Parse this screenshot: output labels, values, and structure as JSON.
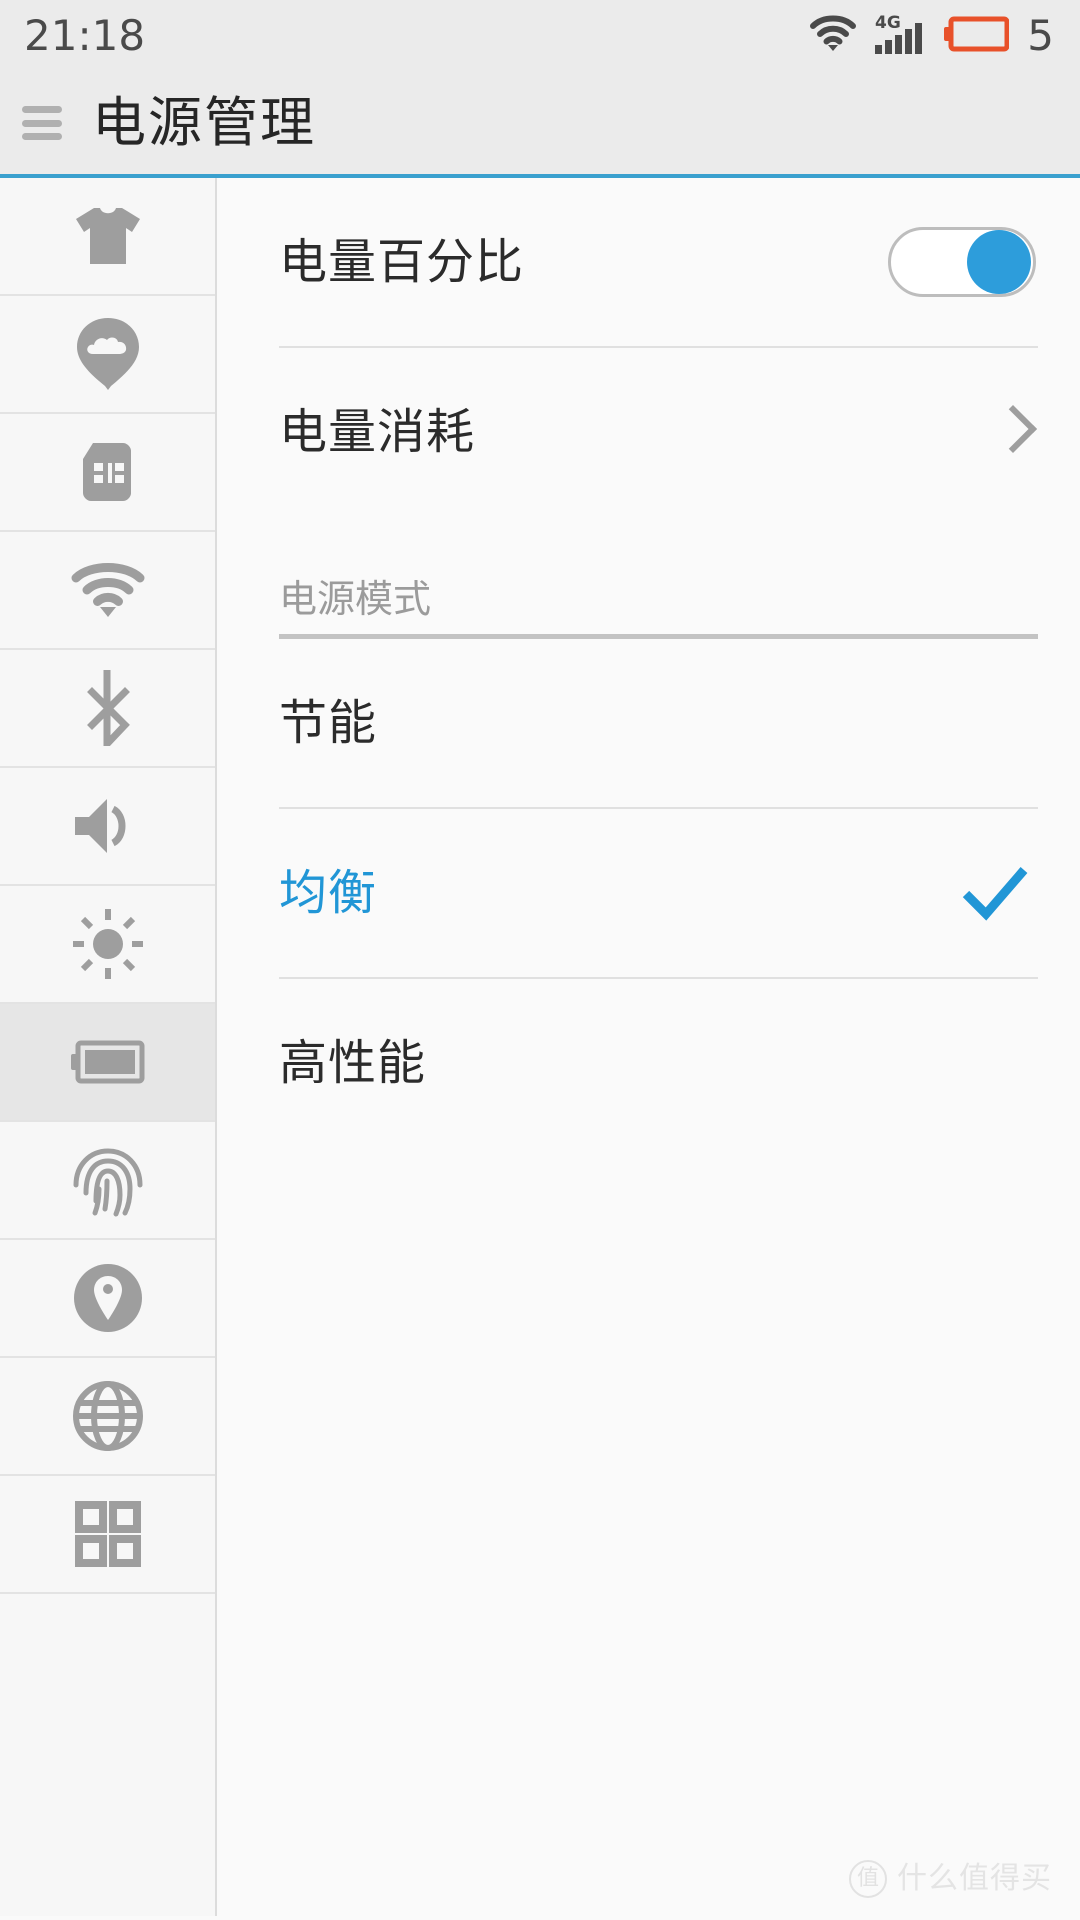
{
  "status_bar": {
    "clock": "21:18",
    "battery_percent": "5",
    "icons": [
      "wifi-icon",
      "signal-4g-icon",
      "battery-low-icon"
    ],
    "network_label": "4G",
    "signal_bars": 5,
    "battery_color": "#e8512a",
    "text_color": "#4a4a4a",
    "background": "#ebebeb"
  },
  "title_bar": {
    "menu_icon": "hamburger-menu-icon",
    "title": "电源管理",
    "accent_color": "#3aa0ce",
    "background": "#ebebeb"
  },
  "sidebar": {
    "selected_index": 7,
    "items": [
      {
        "icon": "tshirt-icon",
        "name": "sidebar-item-theme"
      },
      {
        "icon": "cloud-pin-icon",
        "name": "sidebar-item-cloud"
      },
      {
        "icon": "sim-card-icon",
        "name": "sidebar-item-sim"
      },
      {
        "icon": "wifi-icon",
        "name": "sidebar-item-wifi"
      },
      {
        "icon": "bluetooth-icon",
        "name": "sidebar-item-bluetooth"
      },
      {
        "icon": "volume-icon",
        "name": "sidebar-item-sound"
      },
      {
        "icon": "brightness-sun-icon",
        "name": "sidebar-item-brightness"
      },
      {
        "icon": "battery-icon",
        "name": "sidebar-item-battery"
      },
      {
        "icon": "fingerprint-icon",
        "name": "sidebar-item-fingerprint"
      },
      {
        "icon": "location-pin-icon",
        "name": "sidebar-item-location"
      },
      {
        "icon": "globe-icon",
        "name": "sidebar-item-network"
      },
      {
        "icon": "apps-grid-icon",
        "name": "sidebar-item-apps"
      }
    ]
  },
  "content": {
    "battery_percentage": {
      "label": "电量百分比",
      "toggle_on": true,
      "toggle_color": "#2d9ddb"
    },
    "battery_usage": {
      "label": "电量消耗",
      "chevron": "chevron-right-icon"
    },
    "power_mode_section": {
      "header": "电源模式",
      "selected": "均衡",
      "selected_color": "#2196d6",
      "options": [
        {
          "label": "节能",
          "selected": false
        },
        {
          "label": "均衡",
          "selected": true
        },
        {
          "label": "高性能",
          "selected": false
        }
      ]
    }
  },
  "watermark": {
    "badge": "值",
    "text": "什么值得买"
  }
}
